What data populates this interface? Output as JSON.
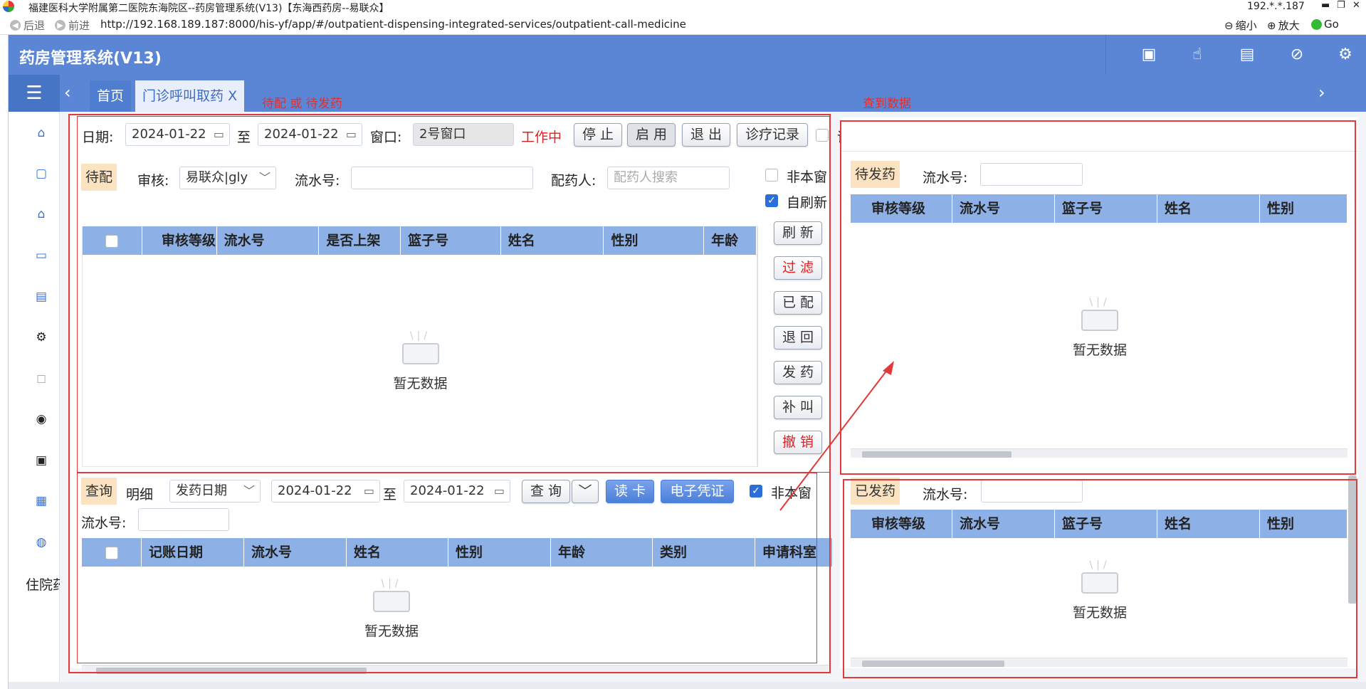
{
  "browser": {
    "title": "福建医科大学附属第二医院东海院区--药房管理系统(V13)【东海西药房--易联众】",
    "ip": "192.*.*.187",
    "back": "后退",
    "forward": "前进",
    "url": "http://192.168.189.187:8000/his-yf/app/#/outpatient-dispensing-integrated-services/outpatient-call-medicine",
    "zoom_out": "缩小",
    "zoom_in": "放大",
    "go": "Go"
  },
  "app": {
    "title": "药房管理系统(V13)",
    "header_icons": [
      "monitor-clock-icon",
      "hand-touch-icon",
      "receipt-icon",
      "circle-slash-icon",
      "gear-icon"
    ]
  },
  "tabs": {
    "home": "首页",
    "active": "门诊呼叫取药",
    "close": "X"
  },
  "annotations": {
    "left_note": "待配 或 待发药",
    "right_note": "查到数据"
  },
  "sidebar": {
    "icons": [
      "building-icon",
      "box-icon",
      "pharmacy-icon",
      "cart-icon",
      "clipboard-icon",
      "settings-icon",
      "bottle-icon",
      "search-circle-icon",
      "medicine-box-icon",
      "doc-search-icon",
      "chart-icon"
    ],
    "more_label": "住院药"
  },
  "filter": {
    "date_label": "日期:",
    "date_from": "2024-01-22",
    "to_label": "至",
    "date_to": "2024-01-22",
    "window_label": "窗口:",
    "window_value": "2号窗口",
    "status": "工作中",
    "stop": "停 止",
    "enable": "启 用",
    "exit": "退 出",
    "records": "诊疗记录",
    "voice": "语音"
  },
  "pending": {
    "tag": "待配",
    "review_label": "审核:",
    "review_value": "易联众|gly",
    "serial_label": "流水号:",
    "serial_value": "",
    "dispenser_label": "配药人:",
    "dispenser_placeholder": "配药人搜索",
    "not_this_window": "非本窗",
    "auto_refresh": "自刷新",
    "columns": [
      "审核等级",
      "流水号",
      "是否上架",
      "篮子号",
      "姓名",
      "性别",
      "年龄"
    ],
    "empty": "暂无数据",
    "buttons": {
      "refresh": "刷 新",
      "filter": "过 滤",
      "done": "已 配",
      "return": "退 回",
      "dispense": "发 药",
      "recall": "补 叫",
      "cancel": "撤 销"
    }
  },
  "query": {
    "tag": "查询",
    "detail": "明细",
    "date_type": "发药日期",
    "date_from": "2024-01-22",
    "to_label": "至",
    "date_to": "2024-01-22",
    "query_btn": "查 询",
    "read_card": "读 卡",
    "e_voucher": "电子凭证",
    "not_this_window": "非本窗",
    "serial_label": "流水号:",
    "columns": [
      "记账日期",
      "流水号",
      "姓名",
      "性别",
      "年龄",
      "类别",
      "申请科室"
    ],
    "empty": "暂无数据"
  },
  "to_dispense": {
    "tag": "待发药",
    "serial_label": "流水号:",
    "columns": [
      "审核等级",
      "流水号",
      "篮子号",
      "姓名",
      "性别"
    ],
    "empty": "暂无数据"
  },
  "dispensed": {
    "tag": "已发药",
    "serial_label": "流水号:",
    "columns": [
      "审核等级",
      "流水号",
      "篮子号",
      "姓名",
      "性别"
    ],
    "empty": "暂无数据"
  }
}
